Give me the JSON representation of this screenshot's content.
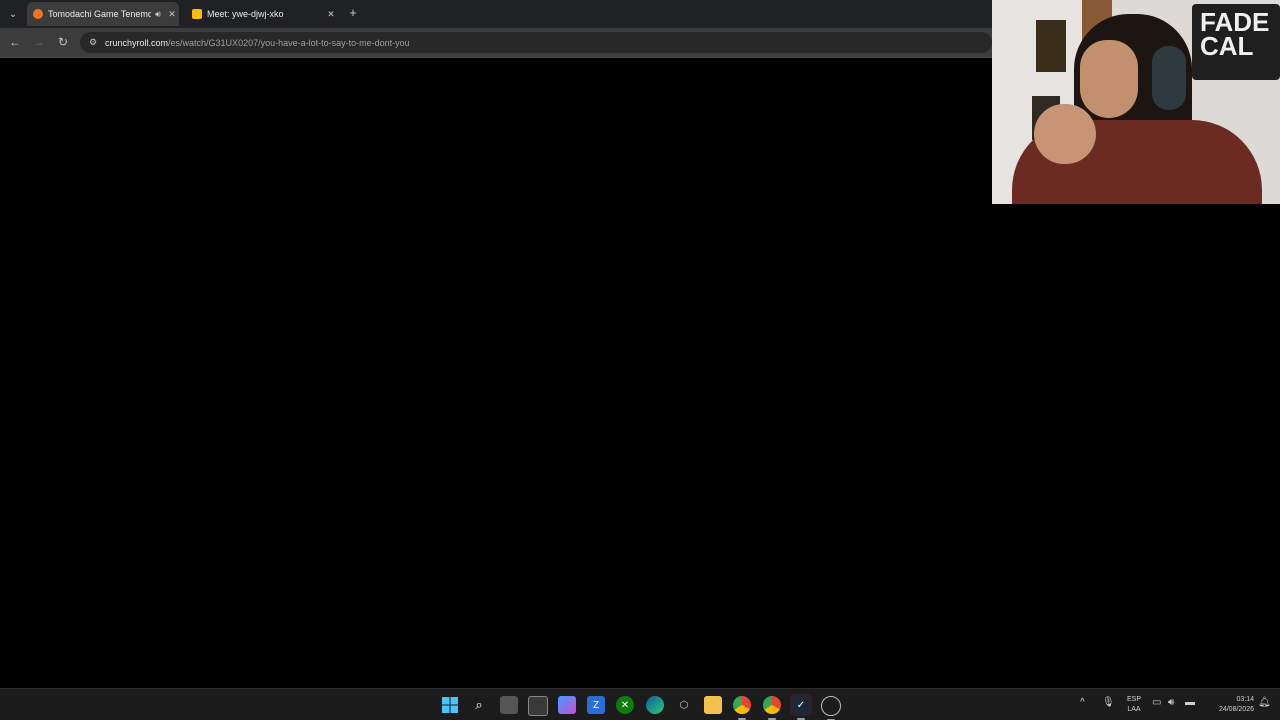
{
  "browser": {
    "tabs": [
      {
        "title": "Tomodachi Game Tenemos",
        "favicon_color": "#f47521",
        "active": true
      },
      {
        "title": "Meet: ywe-djwj-xko",
        "favicon_color": "#fbbc04",
        "active": false
      }
    ],
    "address": {
      "host": "crunchyroll.com",
      "path": "/es/watch/G31UX0207/you-have-a-lot-to-say-to-me-dont-you"
    }
  },
  "webcam": {
    "poster_text": "FADE CAL"
  },
  "taskbar": {
    "icons": [
      "windows-start-icon",
      "search-icon",
      "task-view-icon",
      "store-icon",
      "copilot-icon",
      "app-icon",
      "xbox-icon",
      "edge-icon",
      "settings-icon",
      "file-explorer-icon",
      "chrome-icon",
      "chrome-profile-icon",
      "steam-icon",
      "game-controller-icon"
    ],
    "language_line1": "ESP",
    "language_line2": "LAA",
    "time": "03:14",
    "date": "24/08/2026"
  }
}
